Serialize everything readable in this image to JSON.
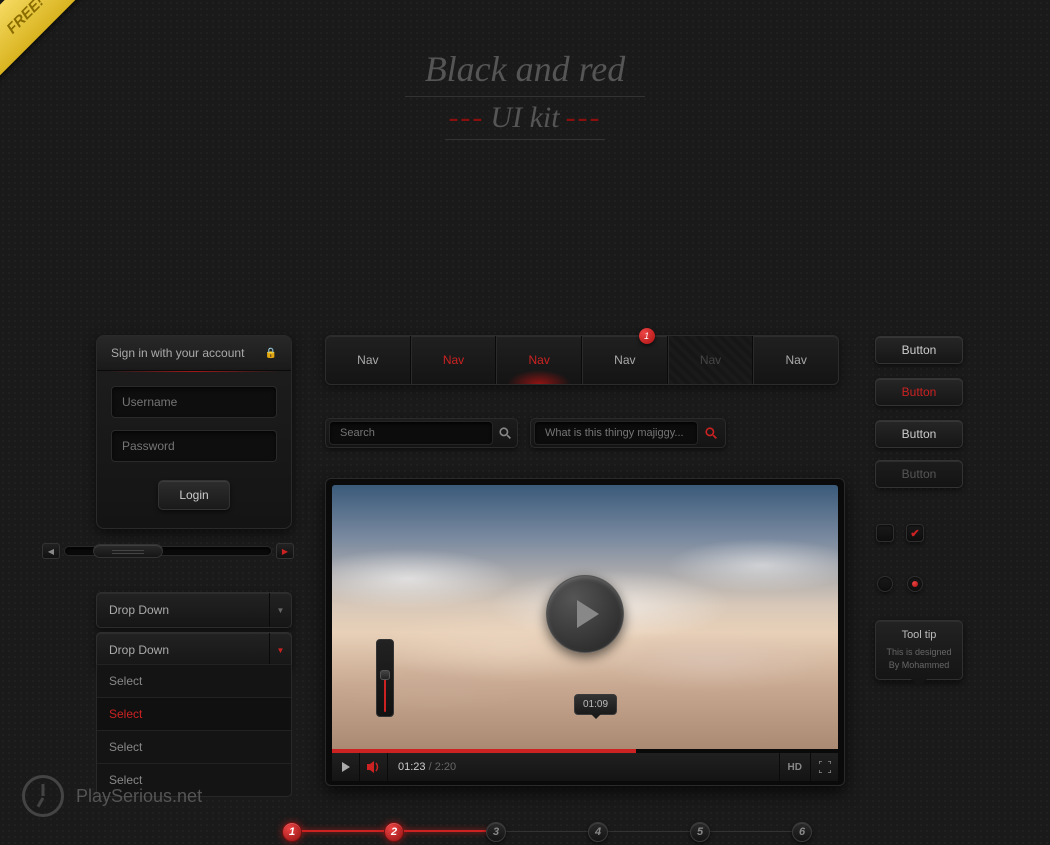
{
  "ribbon": "FREE!",
  "title": {
    "line1": "Black and red",
    "line2": "UI kit"
  },
  "login": {
    "heading": "Sign in with your account",
    "username_ph": "Username",
    "password_ph": "Password",
    "button": "Login"
  },
  "dropdowns": {
    "dd1": "Drop Down",
    "dd2": "Drop Down",
    "options": [
      "Select",
      "Select",
      "Select",
      "Select"
    ],
    "active_index": 1
  },
  "navs": {
    "items": [
      "Nav",
      "Nav",
      "Nav",
      "Nav",
      "Nav",
      "Nav"
    ],
    "badge": "1"
  },
  "search": {
    "ph1": "Search",
    "ph2": "What is this thingy majiggy..."
  },
  "video": {
    "current": "01:23",
    "duration": "2:20",
    "hover_time": "01:09",
    "hd": "HD"
  },
  "buttons": {
    "b1": "Button",
    "b2": "Button",
    "b3": "Button",
    "b4": "Button"
  },
  "tooltip": {
    "title": "Tool tip",
    "body1": "This is designed",
    "body2": "By Mohammed"
  },
  "steps": [
    "1",
    "2",
    "3",
    "4",
    "5",
    "6"
  ],
  "footer": "PlaySerious.net"
}
